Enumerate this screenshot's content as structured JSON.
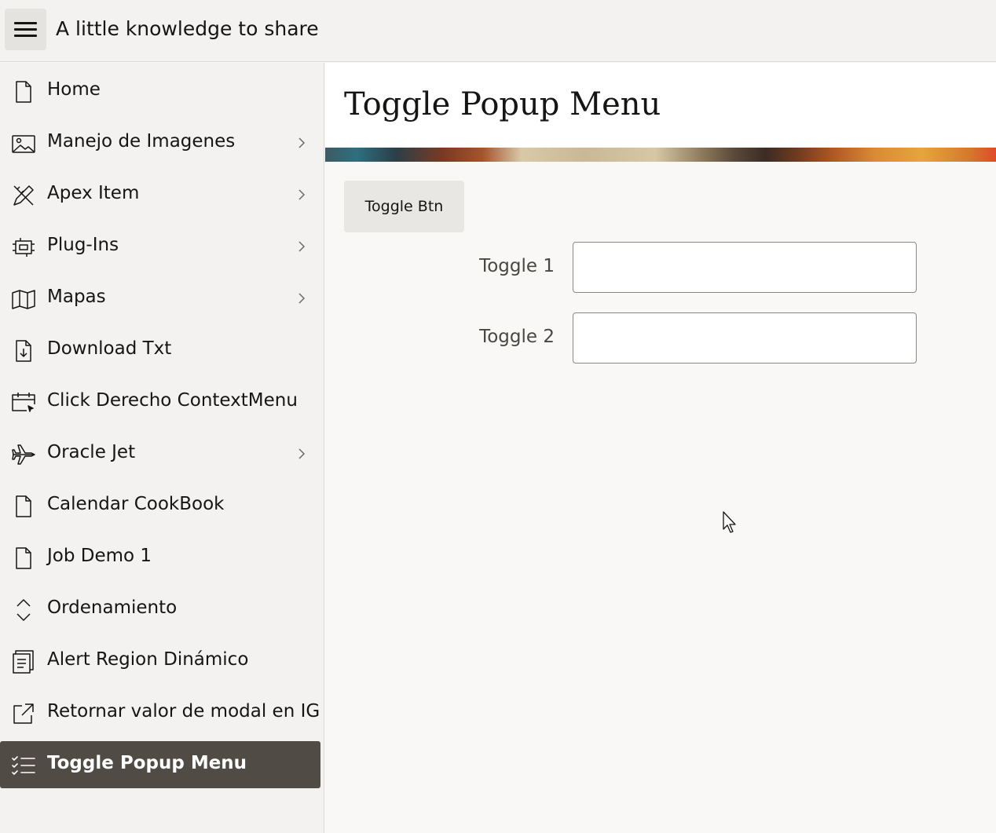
{
  "header": {
    "app_title": "A little knowledge to share"
  },
  "sidebar": {
    "items": [
      {
        "label": "Home",
        "icon": "file-icon",
        "has_children": false,
        "active": false
      },
      {
        "label": "Manejo de Imagenes",
        "icon": "image-icon",
        "has_children": true,
        "active": false
      },
      {
        "label": "Apex Item",
        "icon": "pencil-ruler-icon",
        "has_children": true,
        "active": false
      },
      {
        "label": "Plug-Ins",
        "icon": "plugin-icon",
        "has_children": true,
        "active": false
      },
      {
        "label": "Mapas",
        "icon": "map-icon",
        "has_children": true,
        "active": false
      },
      {
        "label": "Download Txt",
        "icon": "file-download-icon",
        "has_children": false,
        "active": false
      },
      {
        "label": "Click Derecho ContextMenu",
        "icon": "calendar-cursor-icon",
        "has_children": false,
        "active": false
      },
      {
        "label": "Oracle Jet",
        "icon": "jet-plane-icon",
        "has_children": true,
        "active": false
      },
      {
        "label": "Calendar CookBook",
        "icon": "file-icon",
        "has_children": false,
        "active": false
      },
      {
        "label": "Job Demo 1",
        "icon": "file-icon",
        "has_children": false,
        "active": false
      },
      {
        "label": "Ordenamiento",
        "icon": "sort-icon",
        "has_children": false,
        "active": false
      },
      {
        "label": "Alert Region Dinámico",
        "icon": "alert-list-icon",
        "has_children": false,
        "active": false
      },
      {
        "label": "Retornar valor de modal en IG",
        "icon": "external-link-icon",
        "has_children": false,
        "active": false
      },
      {
        "label": "Toggle Popup Menu",
        "icon": "checklist-icon",
        "has_children": false,
        "active": true
      }
    ]
  },
  "main": {
    "page_title": "Toggle Popup Menu",
    "toggle_button_label": "Toggle Btn",
    "fields": [
      {
        "label": "Toggle 1",
        "value": ""
      },
      {
        "label": "Toggle 2",
        "value": ""
      }
    ]
  },
  "colors": {
    "header_bg": "#f3f2f0",
    "active_item_bg": "#504b44",
    "content_bg": "#f9f8f6"
  }
}
